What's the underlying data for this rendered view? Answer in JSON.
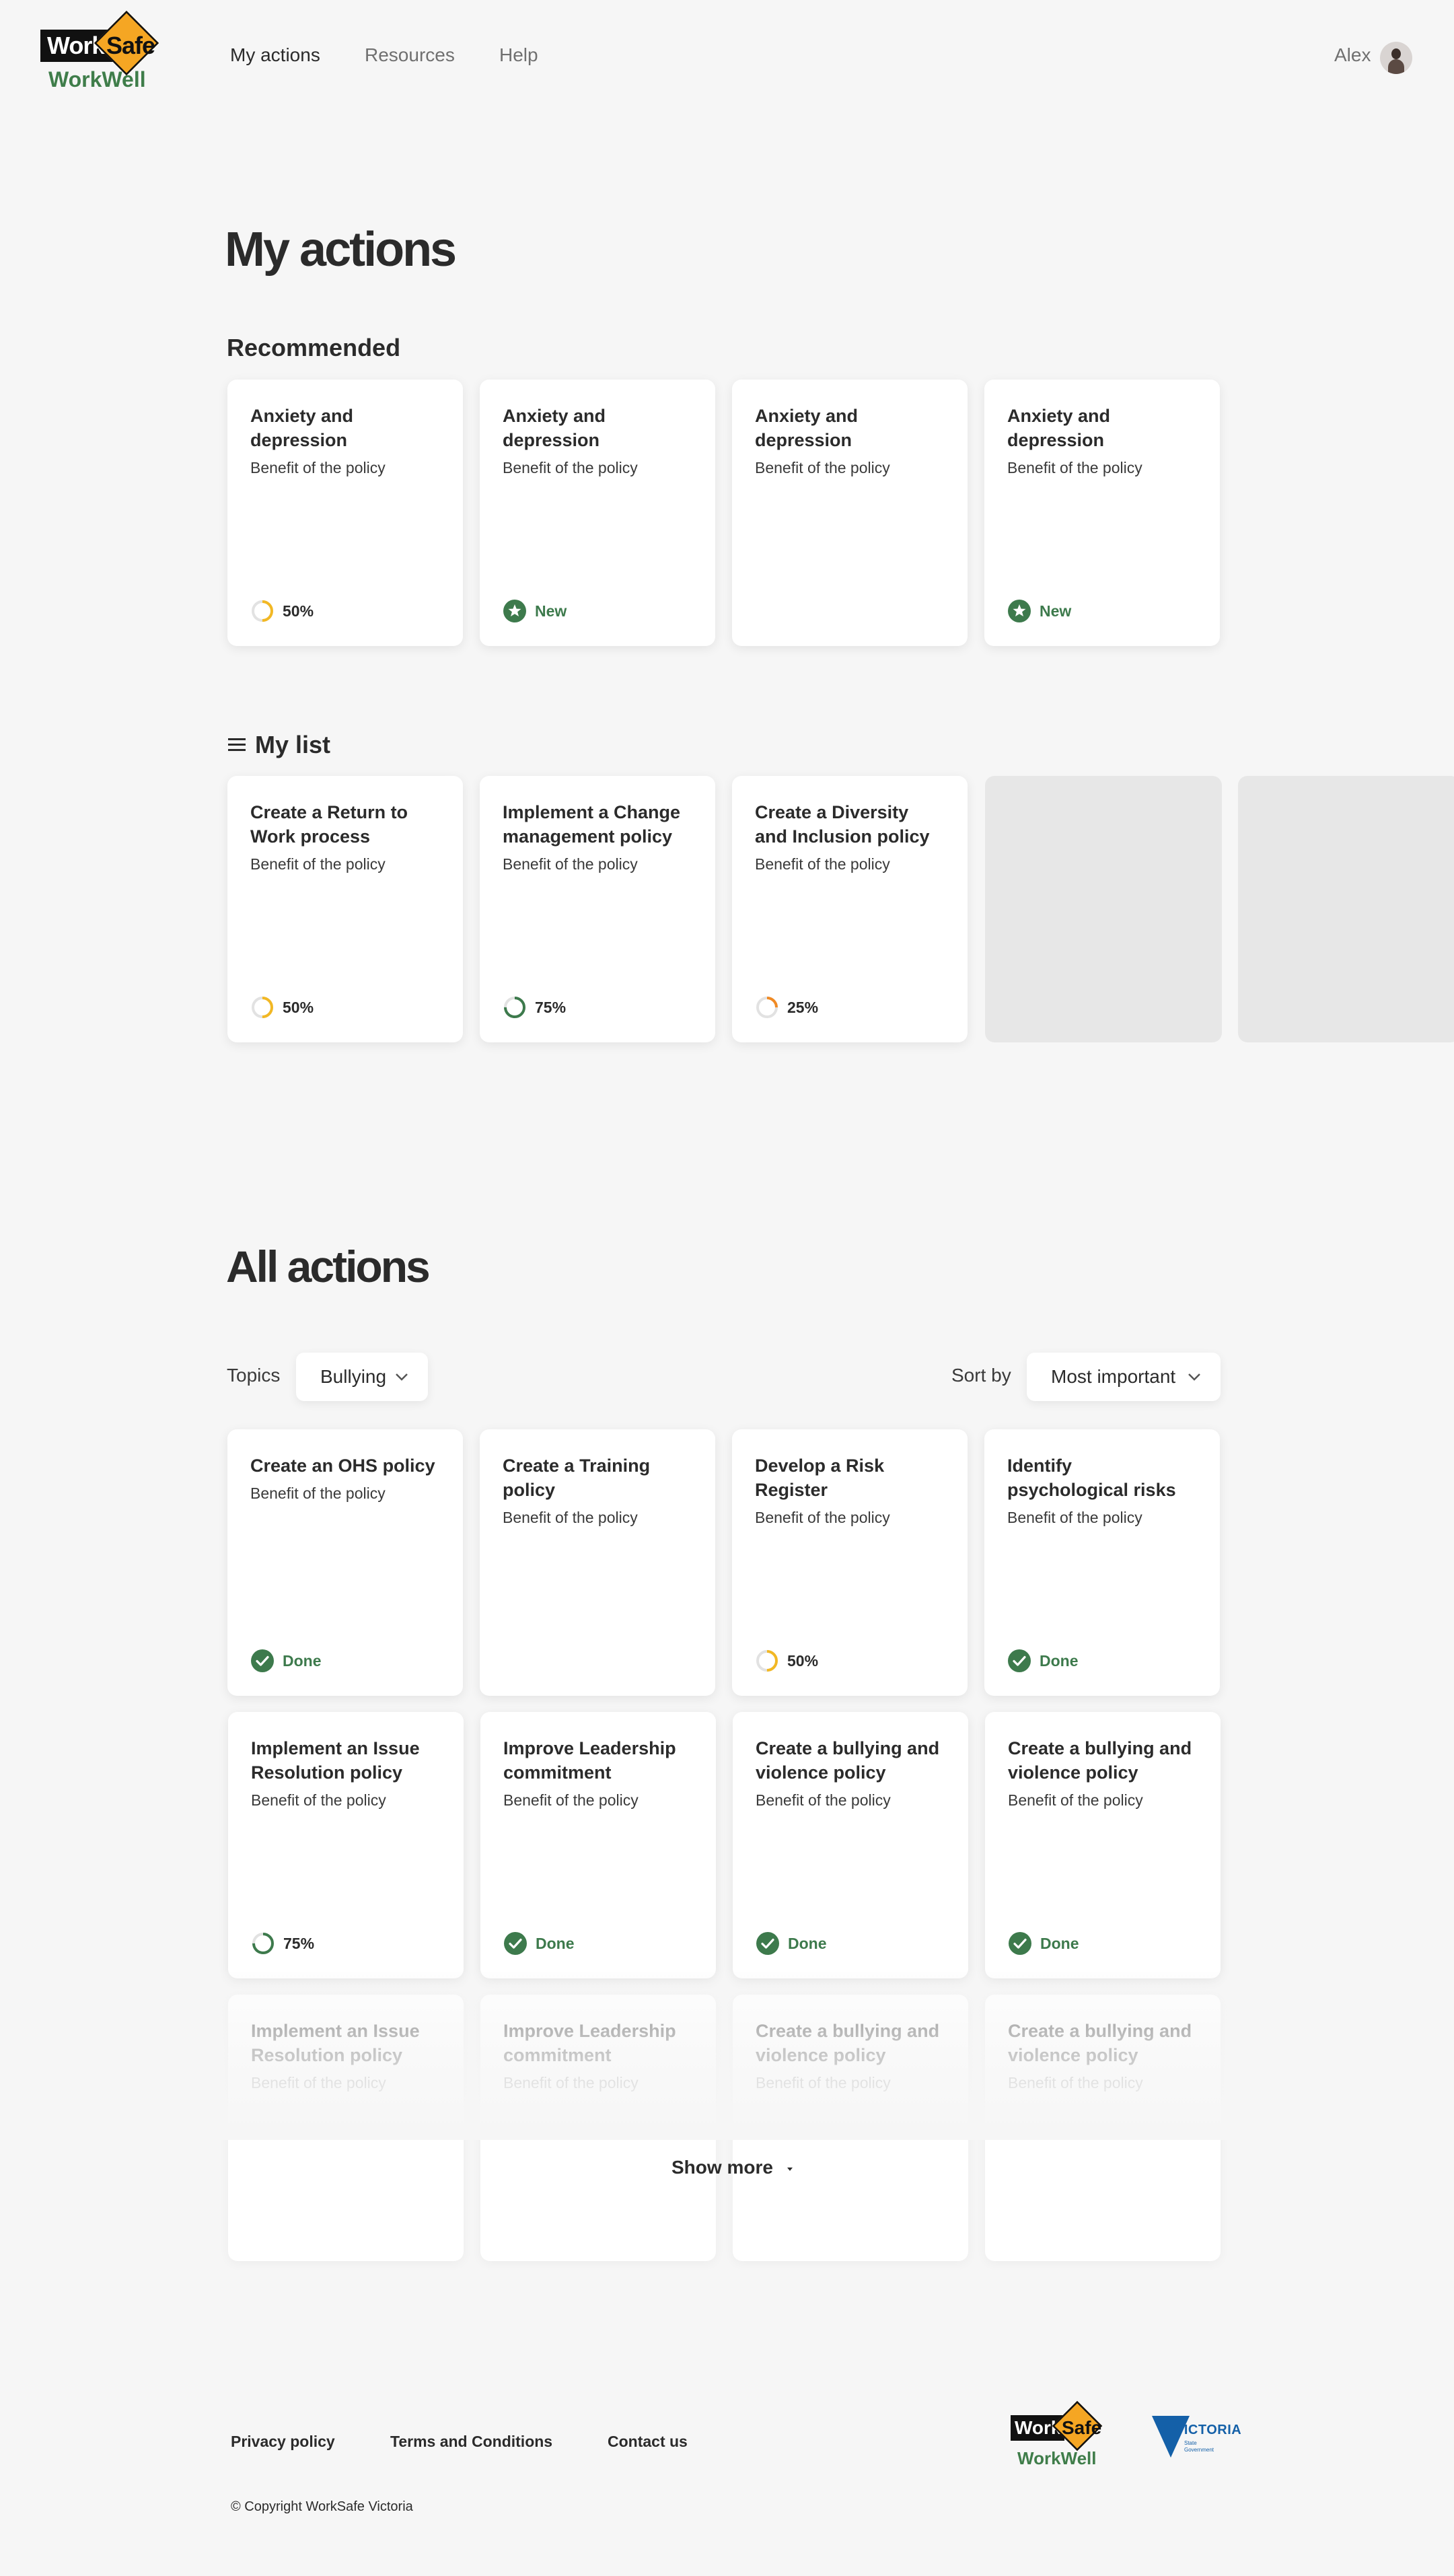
{
  "header": {
    "logo_work": "Work",
    "logo_safe": "Safe",
    "logo_workwell": "WorkWell",
    "nav": [
      "My actions",
      "Resources",
      "Help"
    ],
    "user_name": "Alex"
  },
  "my_actions": {
    "title": "My actions",
    "recommended_title": "Recommended",
    "recommended": [
      {
        "title": "Anxiety and depression",
        "subtitle": "Benefit of the policy",
        "status": "50%",
        "progress": 0.5
      },
      {
        "title": "Anxiety and depression",
        "subtitle": "Benefit of the policy",
        "status": "New"
      },
      {
        "title": "Anxiety and depression",
        "subtitle": "Benefit of the policy",
        "status": ""
      },
      {
        "title": "Anxiety and depression",
        "subtitle": "Benefit of the policy",
        "status": "New"
      }
    ],
    "my_list_title": "My list",
    "my_list": [
      {
        "title": "Create a Return to Work process",
        "subtitle": "Benefit of the policy",
        "status": "50%",
        "progress": 0.5
      },
      {
        "title": "Implement a Change management policy",
        "subtitle": "Benefit of the policy",
        "status": "75%",
        "progress": 0.75
      },
      {
        "title": "Create a Diversity and Inclusion policy",
        "subtitle": "Benefit of the policy",
        "status": "25%",
        "progress": 0.25
      }
    ]
  },
  "all_actions": {
    "title": "All actions",
    "topics_label": "Topics",
    "topics_value": "Bullying",
    "sort_label": "Sort by",
    "sort_value": "Most important",
    "row1": [
      {
        "title": "Create an OHS policy",
        "subtitle": "Benefit of the policy",
        "status": "Done"
      },
      {
        "title": "Create a Training policy",
        "subtitle": "Benefit of the policy",
        "status": ""
      },
      {
        "title": "Develop a Risk Register",
        "subtitle": "Benefit of the policy",
        "status": "50%",
        "progress": 0.5
      },
      {
        "title": "Identify psychological risks",
        "subtitle": "Benefit of the policy",
        "status": "Done"
      }
    ],
    "row2": [
      {
        "title": "Implement an Issue Resolution policy",
        "subtitle": "Benefit of the policy",
        "status": "75%",
        "progress": 0.75
      },
      {
        "title": "Improve Leadership commitment",
        "subtitle": "Benefit of the policy",
        "status": "Done"
      },
      {
        "title": "Create a bullying and violence policy",
        "subtitle": "Benefit of the policy",
        "status": "Done"
      },
      {
        "title": "Create a bullying and violence policy",
        "subtitle": "Benefit of the policy",
        "status": "Done"
      }
    ],
    "row3": [
      {
        "title": "Implement an Issue Resolution policy",
        "subtitle": "Benefit of the policy"
      },
      {
        "title": "Improve Leadership commitment",
        "subtitle": "Benefit of the policy"
      },
      {
        "title": "Create a bullying and violence policy",
        "subtitle": "Benefit of the policy"
      },
      {
        "title": "Create a bullying and violence policy",
        "subtitle": "Benefit of the policy"
      }
    ],
    "show_more": "Show more"
  },
  "footer": {
    "links": [
      "Privacy policy",
      "Terms and Conditions",
      "Contact us"
    ],
    "copyright": "© Copyright WorkSafe Victoria",
    "victoria_logo": "VICTORIA",
    "victoria_sub": "State Government"
  },
  "colors": {
    "green": "#3d7a4c",
    "progress_yellow": "#f2b824",
    "progress_orange": "#f08a24",
    "background": "#f6f6f6"
  }
}
